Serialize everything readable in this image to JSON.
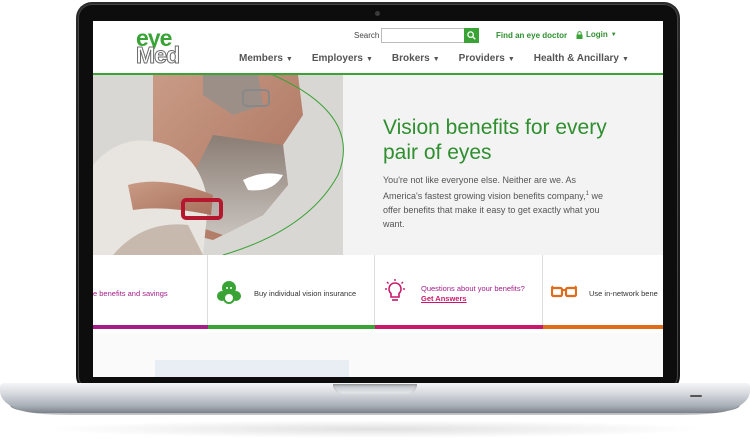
{
  "header": {
    "logo_top": "eye",
    "logo_bottom": "Med",
    "search_label": "Search",
    "search_placeholder": "",
    "find_link": "Find an eye doctor",
    "login": "Login",
    "nav": [
      "Members",
      "Employers",
      "Brokers",
      "Providers",
      "Health & Ancillary"
    ]
  },
  "hero": {
    "title": "Vision benefits for every pair of eyes",
    "body_pre": "You're not like everyone else. Neither are we. As America's fastest growing vision benefits company,",
    "body_sup": "1",
    "body_post": " we offer benefits that make it easy to get exactly what you want."
  },
  "quick_links": [
    {
      "text": "e benefits and savings",
      "color": "#a51c8b"
    },
    {
      "text": "Buy individual vision insurance",
      "color": "#3aa335"
    },
    {
      "question": "Questions about your benefits?",
      "link": "Get Answers",
      "color": "#c9176c"
    },
    {
      "text": "Use in-network bene",
      "color": "#e06c1a"
    }
  ],
  "colors": {
    "brand_green": "#3aa335",
    "magenta": "#c9176c",
    "purple": "#a51c8b",
    "orange": "#e06c1a"
  },
  "icons": [
    "search-icon",
    "lock-icon",
    "family-icon",
    "lightbulb-icon",
    "eyeglasses-icon"
  ]
}
